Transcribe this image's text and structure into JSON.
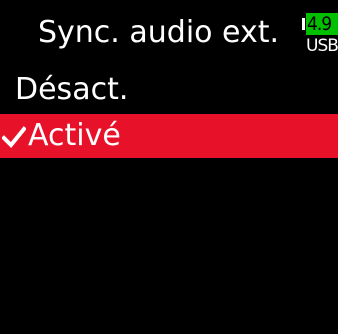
{
  "header": {
    "title": "Sync. audio ext.",
    "battery": {
      "level_text": "4.9",
      "source": "USB",
      "level_color": "#00c000"
    }
  },
  "menu": {
    "items": [
      {
        "label": "Désact.",
        "selected": false
      },
      {
        "label": "Activé",
        "selected": true,
        "mark": "checkmark-icon"
      }
    ],
    "selected_color": "#e8112a"
  }
}
